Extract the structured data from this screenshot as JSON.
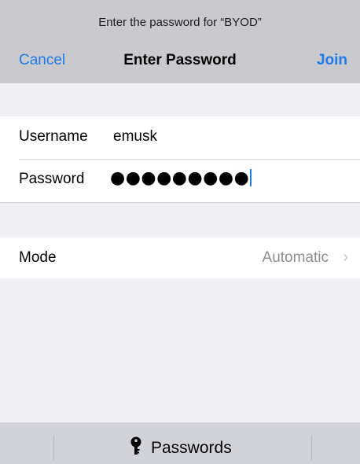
{
  "navbar": {
    "prompt": "Enter the password for “BYOD”",
    "cancel_label": "Cancel",
    "title": "Enter Password",
    "join_label": "Join"
  },
  "credentials": {
    "username_label": "Username",
    "username_value": "emusk",
    "password_label": "Password",
    "password_masked": "●●●●●●●●●"
  },
  "mode": {
    "label": "Mode",
    "value": "Automatic",
    "chevron": "›"
  },
  "keyboard_bar": {
    "passwords_label": "Passwords",
    "icon": "key-icon"
  },
  "colors": {
    "accent": "#1f7aea",
    "navbar_bg": "#c9c9ce",
    "page_bg": "#efeff4",
    "secondary_text": "#8e8e93"
  }
}
